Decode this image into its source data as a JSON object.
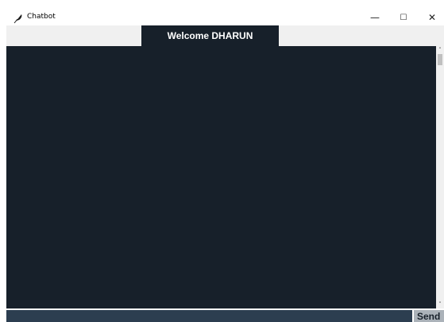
{
  "window": {
    "title": "Chatbot",
    "controls": {
      "minimize": "—",
      "maximize": "☐",
      "close": "✕"
    }
  },
  "header": {
    "welcome_label": "Welcome DHARUN"
  },
  "chat": {
    "messages": []
  },
  "scrollbar": {
    "up_arrow": "˄",
    "down_arrow": "˅"
  },
  "input": {
    "value": "",
    "send_label": "Send"
  },
  "colors": {
    "background": "#17202A",
    "input_background": "#2C3E50",
    "send_background": "#ABB2B9",
    "text": "#EAECEE"
  }
}
